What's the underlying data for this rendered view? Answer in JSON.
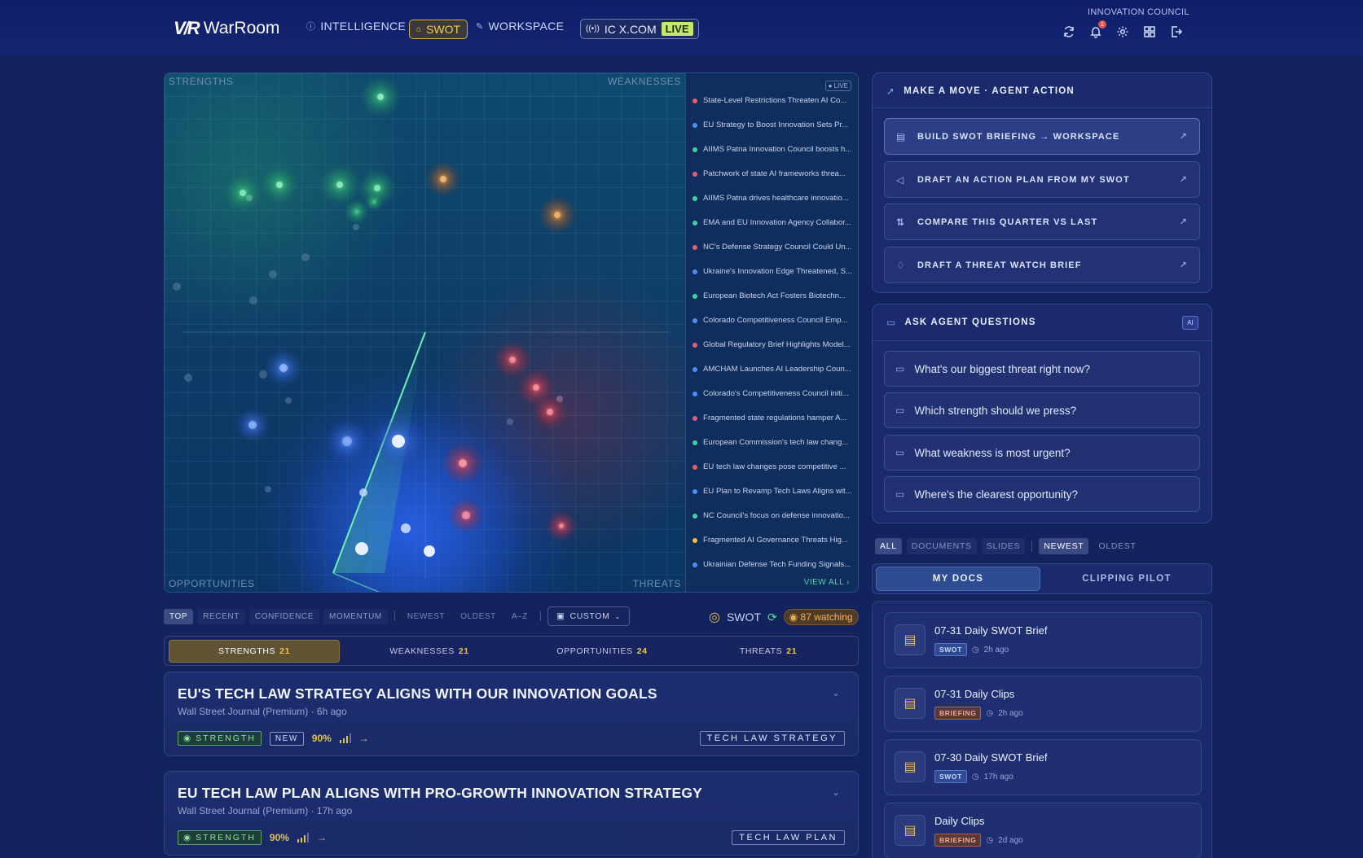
{
  "app": {
    "logo_mark": "V/R",
    "logo_name": "WarRoom"
  },
  "nav": {
    "intelligence": "INTELLIGENCE",
    "swot": "SWOT",
    "workspace": "WORKSPACE",
    "source": "IC X.COM",
    "live": "LIVE"
  },
  "user": {
    "org": "INNOVATION COUNCIL",
    "notifications": "1"
  },
  "quadrants": {
    "tl": "STRENGTHS",
    "tr": "WEAKNESSES",
    "bl": "OPPORTUNITIES",
    "br": "THREATS"
  },
  "feed": {
    "live_tag": "● LIVE",
    "view_all": "VIEW ALL",
    "colors": {
      "threat": "#e25e6a",
      "strength": "#3fd49a",
      "opportunity": "#4d8cff",
      "weakness": "#f0c33c"
    },
    "items": [
      {
        "text": "State-Level Restrictions Threaten AI Co...",
        "type": "threat"
      },
      {
        "text": "EU Strategy to Boost Innovation Sets Pr...",
        "type": "opportunity"
      },
      {
        "text": "AIIMS Patna Innovation Council boosts h...",
        "type": "strength"
      },
      {
        "text": "Patchwork of state AI frameworks threa...",
        "type": "threat"
      },
      {
        "text": "AIIMS Patna drives healthcare innovatio...",
        "type": "strength"
      },
      {
        "text": "EMA and EU Innovation Agency Collabor...",
        "type": "strength"
      },
      {
        "text": "NC's Defense Strategy Council Could Un...",
        "type": "threat"
      },
      {
        "text": "Ukraine's Innovation Edge Threatened, S...",
        "type": "opportunity"
      },
      {
        "text": "European Biotech Act Fosters Biotechn...",
        "type": "strength"
      },
      {
        "text": "Colorado Competitiveness Council Emp...",
        "type": "opportunity"
      },
      {
        "text": "Global Regulatory Brief Highlights Model...",
        "type": "threat"
      },
      {
        "text": "AMCHAM Launches AI Leadership Coun...",
        "type": "opportunity"
      },
      {
        "text": "Colorado's Competitiveness Council initi...",
        "type": "opportunity"
      },
      {
        "text": "Fragmented state regulations hamper A...",
        "type": "threat"
      },
      {
        "text": "European Commission's tech law chang...",
        "type": "strength"
      },
      {
        "text": "EU tech law changes pose competitive ...",
        "type": "threat"
      },
      {
        "text": "EU Plan to Revamp Tech Laws Aligns wit...",
        "type": "opportunity"
      },
      {
        "text": "NC Council's focus on defense innovatio...",
        "type": "strength"
      },
      {
        "text": "Fragmented AI Governance Threats Hig...",
        "type": "weakness"
      },
      {
        "text": "Ukrainian Defense Tech Funding Signals...",
        "type": "opportunity"
      }
    ]
  },
  "sort": {
    "top": "TOP",
    "recent": "RECENT",
    "confidence": "CONFIDENCE",
    "momentum": "MOMENTUM",
    "newest": "NEWEST",
    "oldest": "OLDEST",
    "az": "A–Z",
    "custom": "CUSTOM"
  },
  "status": {
    "label": "SWOT",
    "watching": "87 watching"
  },
  "tabs": [
    {
      "label": "STRENGTHS",
      "count": "21"
    },
    {
      "label": "WEAKNESSES",
      "count": "21"
    },
    {
      "label": "OPPORTUNITIES",
      "count": "24"
    },
    {
      "label": "THREATS",
      "count": "21"
    }
  ],
  "cards": [
    {
      "title": "EU'S TECH LAW STRATEGY ALIGNS WITH OUR INNOVATION GOALS",
      "meta": "Wall Street Journal (Premium) · 6h ago",
      "type": "STRENGTH",
      "new": "NEW",
      "confidence": "90%",
      "tag": "TECH LAW STRATEGY"
    },
    {
      "title": "EU TECH LAW PLAN ALIGNS WITH PRO-GROWTH INNOVATION STRATEGY",
      "meta": "Wall Street Journal (Premium) · 17h ago",
      "type": "STRENGTH",
      "confidence": "90%",
      "tag": "TECH LAW PLAN"
    }
  ],
  "actions": {
    "title": "MAKE A MOVE · AGENT ACTION",
    "items": [
      "BUILD SWOT BRIEFING → WORKSPACE",
      "DRAFT AN ACTION PLAN FROM MY SWOT",
      "COMPARE THIS QUARTER VS LAST",
      "DRAFT A THREAT WATCH BRIEF"
    ]
  },
  "questions": {
    "title": "ASK AGENT QUESTIONS",
    "badge": "AI",
    "items": [
      "What's our biggest threat right now?",
      "Which strength should we press?",
      "What weakness is most urgent?",
      "Where's the clearest opportunity?"
    ]
  },
  "doc_filters": {
    "all": "ALL",
    "documents": "DOCUMENTS",
    "slides": "SLIDES",
    "newest": "NEWEST",
    "oldest": "OLDEST"
  },
  "doc_tabs": {
    "mine": "MY DOCS",
    "clipping": "CLIPPING PILOT"
  },
  "docs": [
    {
      "title": "07-31 Daily SWOT Brief",
      "tag": "SWOT",
      "time": "2h ago"
    },
    {
      "title": "07-31 Daily Clips",
      "tag": "BRIEFING",
      "time": "2h ago"
    },
    {
      "title": "07-30 Daily SWOT Brief",
      "tag": "SWOT",
      "time": "17h ago"
    },
    {
      "title": "Daily Clips",
      "tag": "BRIEFING",
      "time": "2d ago"
    }
  ]
}
